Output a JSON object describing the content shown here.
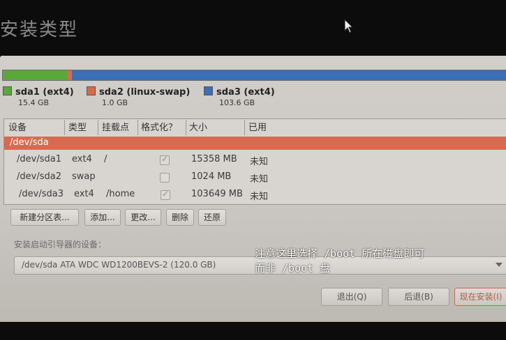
{
  "window": {
    "title": "安装类型"
  },
  "disk_bar": {
    "segments": [
      {
        "name": "sda1",
        "fraction": 0.128,
        "color": "#5aa83a"
      },
      {
        "name": "sda2",
        "fraction": 0.009,
        "color": "#d96a4a"
      },
      {
        "name": "sda3",
        "fraction": 0.863,
        "color": "#3b6fb6"
      }
    ]
  },
  "legend": [
    {
      "label": "sda1 (ext4)",
      "size": "15.4 GB",
      "color": "#5aa83a"
    },
    {
      "label": "sda2 (linux-swap)",
      "size": "1.0 GB",
      "color": "#d96a4a"
    },
    {
      "label": "sda3 (ext4)",
      "size": "103.6 GB",
      "color": "#3b6fb6"
    }
  ],
  "table": {
    "headers": [
      "设备",
      "类型",
      "挂载点",
      "格式化？",
      "大小",
      "已用"
    ],
    "device": "/dev/sda",
    "rows": [
      {
        "device": "/dev/sda1",
        "type": "ext4",
        "mount": "/",
        "format": true,
        "size": "15358 MB",
        "used": "未知"
      },
      {
        "device": "/dev/sda2",
        "type": "swap",
        "mount": "",
        "format": false,
        "size": "1024 MB",
        "used": "未知"
      },
      {
        "device": "/dev/sda3",
        "type": "ext4",
        "mount": "/home",
        "format": true,
        "size": "103649 MB",
        "used": "未知"
      }
    ]
  },
  "buttons": {
    "new_table": "新建分区表...",
    "add": "添加...",
    "change": "更改...",
    "delete": "删除",
    "revert": "还原"
  },
  "bootloader": {
    "label": "安装启动引导器的设备：",
    "value": "/dev/sda   ATA WDC WD1200BEVS-2 (120.0 GB)"
  },
  "annotation": {
    "line1": "注意这里选择 /boot 所在磁盘即可",
    "line2": "而非 /boot 盘"
  },
  "bottom_buttons": {
    "quit": "退出(Q)",
    "back": "后退(B)",
    "install": "现在安装(I)"
  }
}
